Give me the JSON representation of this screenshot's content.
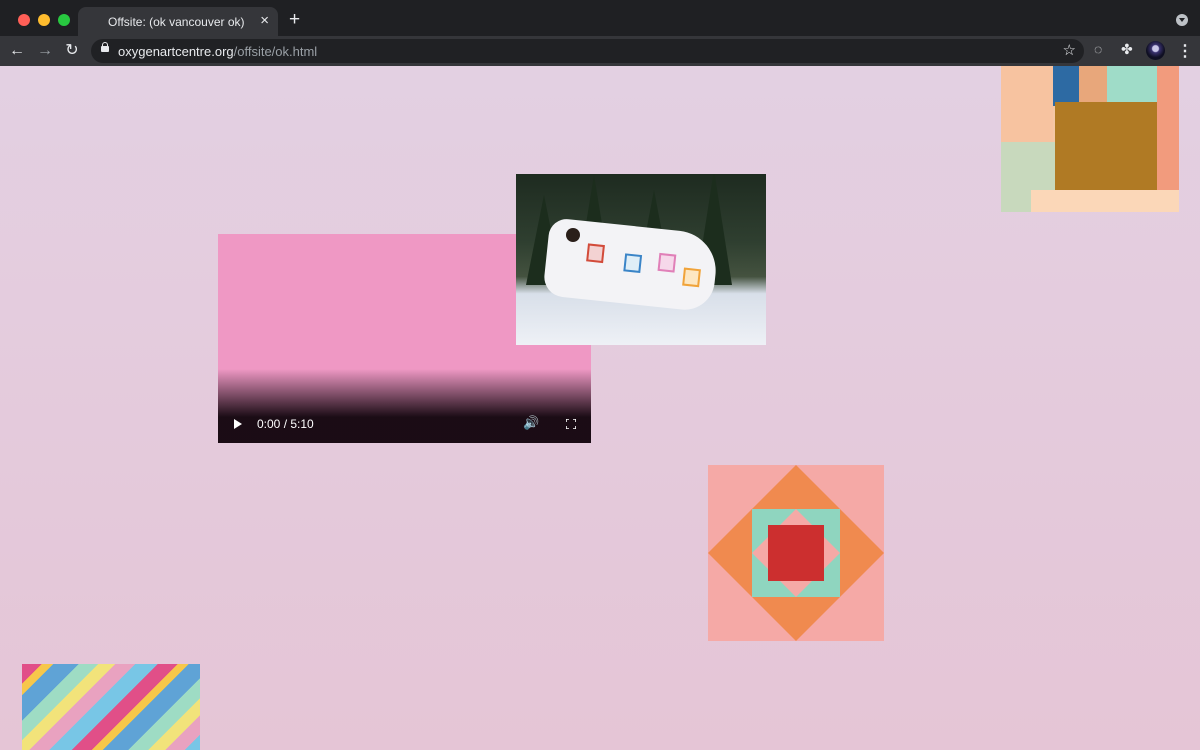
{
  "browser": {
    "tab_title": "Offsite: (ok vancouver ok)",
    "tab_close": "×",
    "new_tab": "+",
    "url_host": "oxygenartcentre.org",
    "url_path": "/offsite/ok.html",
    "nav_icons": [
      "back-arrow-icon",
      "forward-arrow-icon",
      "reload-icon"
    ],
    "star_glyph": "☆",
    "menu_glyph": "⋮"
  },
  "video": {
    "time": "0:00 / 5:10",
    "background_color": "#ef98c4",
    "volume_glyph": "🔊"
  },
  "images": [
    {
      "id": "quilt-corner-patchwork"
    },
    {
      "id": "person-wrapped-in-quilt-in-snow"
    },
    {
      "id": "star-quilt-block"
    },
    {
      "id": "diagonal-strip-quilt"
    }
  ],
  "colors": {
    "page_background_top": "#e3d0e2",
    "page_background_bottom": "#e5c5d6",
    "chrome_dark": "#1f2023",
    "chrome_toolbar": "#35363a"
  }
}
